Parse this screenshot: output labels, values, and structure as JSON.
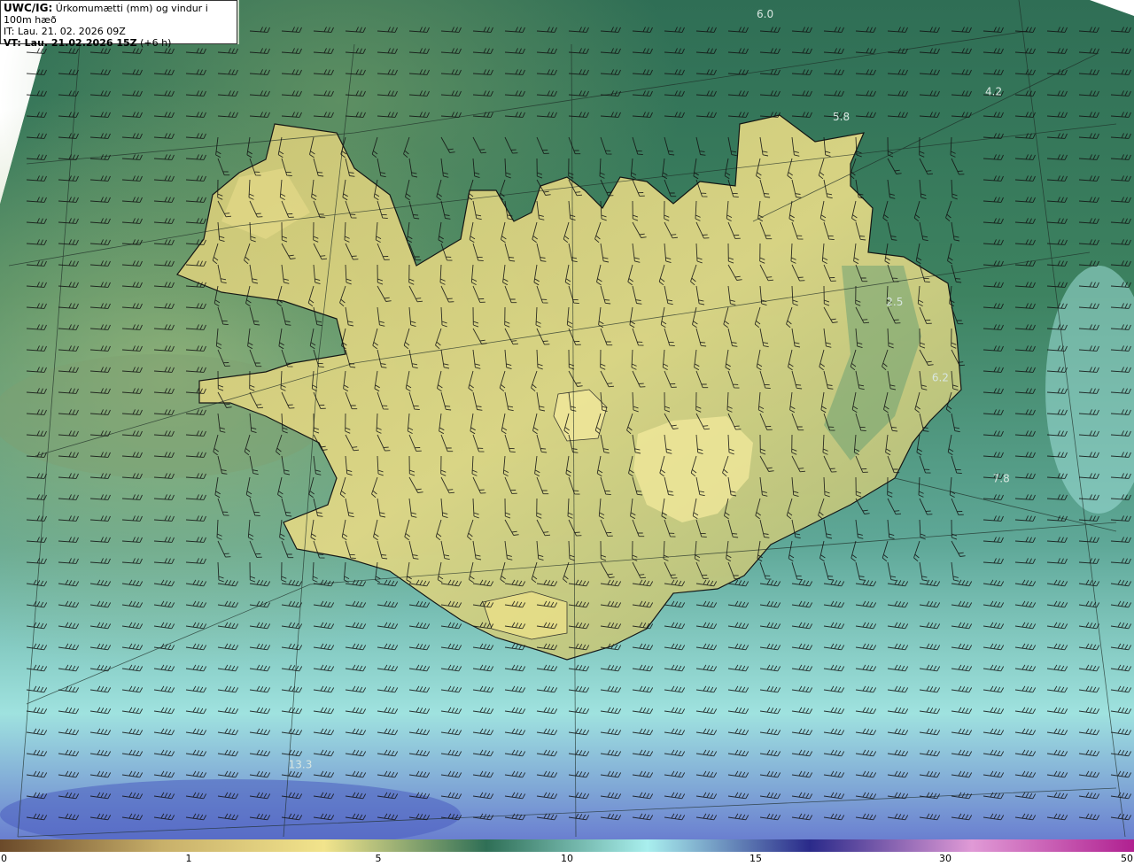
{
  "header": {
    "model": "UWC/IG:",
    "title": "Úrkomumætti (mm) og vindur i 100m hæð",
    "it_label": "IT: Lau. 21. 02. 2026 09Z",
    "vt_label": "VT: Lau. 21.02.2026 15Z",
    "vt_offset": "(+6 h)"
  },
  "contour_labels": [
    {
      "text": "6.0",
      "lon": -15.9,
      "lat": 67.35
    },
    {
      "text": "5.8",
      "lon": -14.9,
      "lat": 66.6
    },
    {
      "text": "4.2",
      "lon": -12.9,
      "lat": 66.75
    },
    {
      "text": "2.5",
      "lon": -14.2,
      "lat": 65.5
    },
    {
      "text": "6.2",
      "lon": -13.6,
      "lat": 65.05
    },
    {
      "text": "7.8",
      "lon": -12.8,
      "lat": 64.45
    },
    {
      "text": "13.3",
      "lon": -22.0,
      "lat": 62.75
    }
  ],
  "legend": {
    "ticks": [
      "0",
      "1",
      "5",
      "10",
      "15",
      "30",
      "50"
    ],
    "colors": [
      "#6b4a2a",
      "#c8b06a",
      "#f2e48c",
      "#2f6f56",
      "#a9efee",
      "#2a2a8a",
      "#e09ad6",
      "#b02090"
    ]
  },
  "colors": {
    "sea_low": "#2f6b52",
    "land": "#d8d07a",
    "coast": "#111111"
  }
}
